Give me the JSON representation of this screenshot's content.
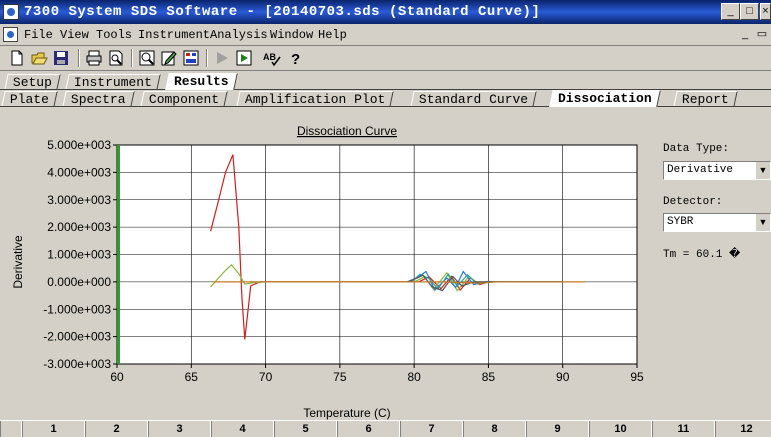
{
  "window": {
    "title": "7300 System SDS Software - [20140703.sds (Standard Curve)]",
    "buttons": {
      "minimize": "_",
      "maximize": "□",
      "close": "×"
    }
  },
  "menu": {
    "items": [
      "File",
      "View",
      "Tools",
      "Instrument",
      "Analysis",
      "Window",
      "Help"
    ],
    "mdi": {
      "minimize": "_",
      "restore": "▭"
    }
  },
  "toolbar": {
    "icons": [
      "new-icon",
      "open-icon",
      "save-icon",
      "print-icon",
      "print-preview-icon",
      "zoom-icon",
      "edit-icon",
      "plate-icon",
      "run-icon",
      "run-monitor-icon",
      "spell-check-icon",
      "help-icon"
    ]
  },
  "tabs_top": [
    {
      "label": "Setup",
      "active": false
    },
    {
      "label": "Instrument",
      "active": false
    },
    {
      "label": "Results",
      "active": true
    }
  ],
  "tabs_results": [
    {
      "label": "Plate",
      "active": false
    },
    {
      "label": "Spectra",
      "active": false
    },
    {
      "label": "Component",
      "active": false
    },
    {
      "label": "Amplification Plot",
      "active": false
    },
    {
      "label": "Standard Curve",
      "active": false
    },
    {
      "label": "Dissociation",
      "active": true
    },
    {
      "label": "Report",
      "active": false
    }
  ],
  "options": {
    "data_type_label": "Data Type:",
    "data_type_value": "Derivative",
    "detector_label": "Detector:",
    "detector_value": "SYBR",
    "tm_text": "Tm = 60.1 �"
  },
  "plate_columns": [
    "1",
    "2",
    "3",
    "4",
    "5",
    "6",
    "7",
    "8",
    "9",
    "10",
    "11",
    "12"
  ],
  "chart_data": {
    "type": "line",
    "title": "Dissociation Curve",
    "xlabel": "Temperature (C)",
    "ylabel": "Derivative",
    "xlim": [
      60,
      95
    ],
    "ylim": [
      -3000,
      5000
    ],
    "x_ticks": [
      60,
      65,
      70,
      75,
      80,
      85,
      90,
      95
    ],
    "y_ticks": [
      {
        "value": 5000,
        "label": "5.000e+003"
      },
      {
        "value": 4000,
        "label": "4.000e+003"
      },
      {
        "value": 3000,
        "label": "3.000e+003"
      },
      {
        "value": 2000,
        "label": "2.000e+003"
      },
      {
        "value": 1000,
        "label": "1.000e+003"
      },
      {
        "value": 0,
        "label": "0.000e+000"
      },
      {
        "value": -1000,
        "label": "-1.000e+003"
      },
      {
        "value": -2000,
        "label": "-2.000e+003"
      },
      {
        "value": -3000,
        "label": "-3.000e+003"
      }
    ],
    "grid": true,
    "tm_marker": 60.1,
    "colors": {
      "tm_marker": "#2e9a2e"
    },
    "series": [
      {
        "color": "#cc2020",
        "points": [
          [
            66.3,
            1850
          ],
          [
            66.8,
            2900
          ],
          [
            67.3,
            4000
          ],
          [
            67.8,
            4650
          ],
          [
            68.2,
            2000
          ],
          [
            68.4,
            -500
          ],
          [
            68.6,
            -2100
          ],
          [
            69.0,
            -150
          ],
          [
            69.6,
            0
          ],
          [
            72,
            0
          ],
          [
            75,
            0
          ],
          [
            78,
            0
          ],
          [
            80.3,
            0
          ],
          [
            81.0,
            180
          ],
          [
            81.8,
            -250
          ],
          [
            82.5,
            200
          ],
          [
            83.1,
            -300
          ],
          [
            83.8,
            150
          ],
          [
            84.4,
            -100
          ],
          [
            85,
            0
          ],
          [
            88,
            0
          ],
          [
            90,
            0
          ]
        ]
      },
      {
        "color": "#8cb43c",
        "points": [
          [
            66.3,
            -180
          ],
          [
            66.8,
            120
          ],
          [
            67.3,
            420
          ],
          [
            67.7,
            620
          ],
          [
            68.2,
            300
          ],
          [
            68.6,
            -80
          ],
          [
            69.2,
            -30
          ],
          [
            70,
            0
          ],
          [
            74,
            0
          ],
          [
            78,
            0
          ],
          [
            80,
            0
          ],
          [
            80.7,
            180
          ],
          [
            81.3,
            -280
          ],
          [
            82.2,
            330
          ],
          [
            82.9,
            -320
          ],
          [
            83.7,
            200
          ],
          [
            84.3,
            -80
          ],
          [
            85,
            0
          ],
          [
            90,
            0
          ]
        ]
      },
      {
        "color": "#2a78c8",
        "points": [
          [
            79.5,
            0
          ],
          [
            80.2,
            150
          ],
          [
            80.8,
            380
          ],
          [
            81.4,
            -300
          ],
          [
            82.2,
            140
          ],
          [
            82.8,
            -200
          ],
          [
            83.3,
            380
          ],
          [
            84.0,
            -100
          ],
          [
            84.8,
            0
          ],
          [
            90,
            0
          ]
        ]
      },
      {
        "color": "#2aa39c",
        "points": [
          [
            79.8,
            0
          ],
          [
            80.4,
            280
          ],
          [
            81.0,
            120
          ],
          [
            81.6,
            -260
          ],
          [
            82.3,
            280
          ],
          [
            82.9,
            -150
          ],
          [
            83.6,
            260
          ],
          [
            84.2,
            -60
          ],
          [
            85,
            0
          ],
          [
            90,
            0
          ]
        ]
      },
      {
        "color": "#555555",
        "points": [
          [
            79.6,
            0
          ],
          [
            80.6,
            240
          ],
          [
            81.2,
            -180
          ],
          [
            81.9,
            -320
          ],
          [
            82.6,
            200
          ],
          [
            83.2,
            -150
          ],
          [
            84.0,
            0
          ],
          [
            86,
            0
          ]
        ]
      },
      {
        "color": "#c07820",
        "points": [
          [
            66.5,
            0
          ],
          [
            70,
            0
          ],
          [
            73,
            0
          ],
          [
            76,
            0
          ],
          [
            80,
            0
          ],
          [
            82,
            0
          ],
          [
            84.5,
            -50
          ],
          [
            85.5,
            0
          ],
          [
            91.5,
            0
          ]
        ]
      }
    ]
  }
}
